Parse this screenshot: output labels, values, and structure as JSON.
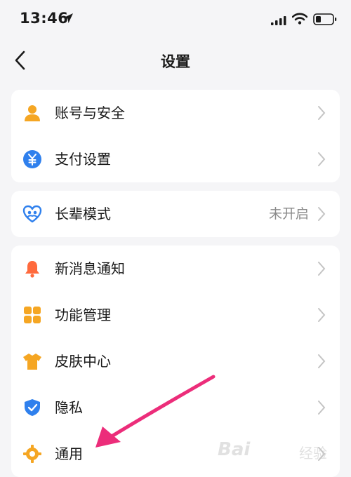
{
  "status_bar": {
    "time": "13:46",
    "icons": [
      "location-arrow-icon",
      "cellular-signal-icon",
      "wifi-icon",
      "battery-icon"
    ]
  },
  "nav": {
    "title": "设置",
    "back_icon": "chevron-left-icon"
  },
  "groups": [
    {
      "items": [
        {
          "label": "账号与安全",
          "icon": "person-icon",
          "color": "#f5a623"
        },
        {
          "label": "支付设置",
          "icon": "yuan-circle-icon",
          "color": "#2f80ed"
        }
      ]
    },
    {
      "items": [
        {
          "label": "长辈模式",
          "icon": "heart-people-icon",
          "color": "#2f80ed",
          "value": "未开启"
        }
      ]
    },
    {
      "items": [
        {
          "label": "新消息通知",
          "icon": "bell-icon",
          "color": "#ff6a3d"
        },
        {
          "label": "功能管理",
          "icon": "grid-icon",
          "color": "#f5a623"
        },
        {
          "label": "皮肤中心",
          "icon": "tshirt-icon",
          "color": "#f5a623"
        },
        {
          "label": "隐私",
          "icon": "shield-check-icon",
          "color": "#2f80ed"
        },
        {
          "label": "通用",
          "icon": "gear-icon",
          "color": "#f5a623"
        }
      ]
    }
  ],
  "annotation": {
    "icon": "pink-arrow-icon",
    "color": "#ec2d7a"
  },
  "watermark": {
    "text": "Bai",
    "sub": "经验"
  }
}
